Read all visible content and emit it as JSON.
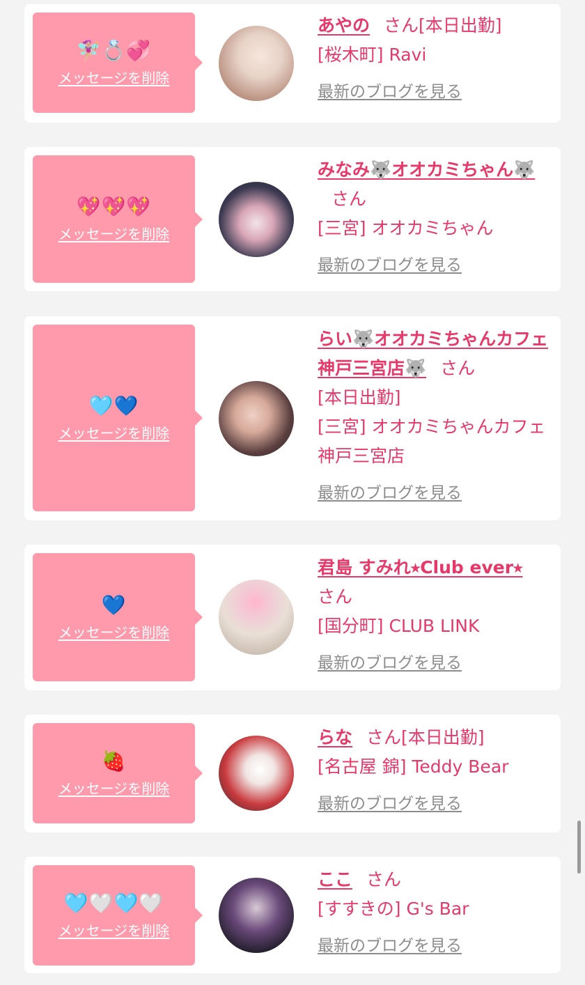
{
  "messages": [
    {
      "emoji": "🧚🏼‍♀️💍💞",
      "delete_label": "メッセージを削除",
      "name": "あやの",
      "san": "さん",
      "status": "[本日出勤]",
      "shop": "[桜木町] Ravi",
      "blog_label": "最新のブログを見る",
      "avatar_colors": [
        "#e8d3c8",
        "#b88f7e"
      ]
    },
    {
      "emoji": "💖💖💖",
      "delete_label": "メッセージを削除",
      "name": "みなみ🐺オオカミちゃん🐺",
      "san": "さん",
      "status": "",
      "shop": "[三宮] オオカミちゃん",
      "blog_label": "最新のブログを見る",
      "avatar_colors": [
        "#3c3a52",
        "#d9a7b7"
      ]
    },
    {
      "emoji": "🩵💙",
      "delete_label": "メッセージを削除",
      "name": "らい🐺オオカミちゃんカフェ神戸三宮店🐺",
      "san": "さん",
      "status": "[本日出勤]",
      "shop": "[三宮] オオカミちゃんカフェ神戸三宮店",
      "blog_label": "最新のブログを見る",
      "avatar_colors": [
        "#2a2327",
        "#d6a99a"
      ]
    },
    {
      "emoji": "💙",
      "delete_label": "メッセージを削除",
      "name": "君島 すみれ⭑Club ever⭑",
      "san": "さん",
      "status": "",
      "shop": "[国分町] CLUB LINK",
      "blog_label": "最新のブログを見る",
      "avatar_colors": [
        "#e9dfd6",
        "#ffb6cb"
      ]
    },
    {
      "emoji": "🍓",
      "delete_label": "メッセージを削除",
      "name": "らな",
      "san": "さん",
      "status": "[本日出勤]",
      "shop": "[名古屋 錦] Teddy Bear",
      "blog_label": "最新のブログを見る",
      "avatar_colors": [
        "#c93a3e",
        "#f1e6e4"
      ]
    },
    {
      "emoji": "🩵🤍🩵🤍",
      "delete_label": "メッセージを削除",
      "name": "ここ",
      "san": "さん",
      "status": "",
      "shop": "[すすきの] G's Bar",
      "blog_label": "最新のブログを見る",
      "avatar_colors": [
        "#1d1a26",
        "#6a4a7a"
      ]
    }
  ],
  "colors": {
    "bubble": "#fe9aab",
    "accent": "#e6396a",
    "link_gray": "#8c8c8c",
    "background": "#f3f3f3"
  }
}
